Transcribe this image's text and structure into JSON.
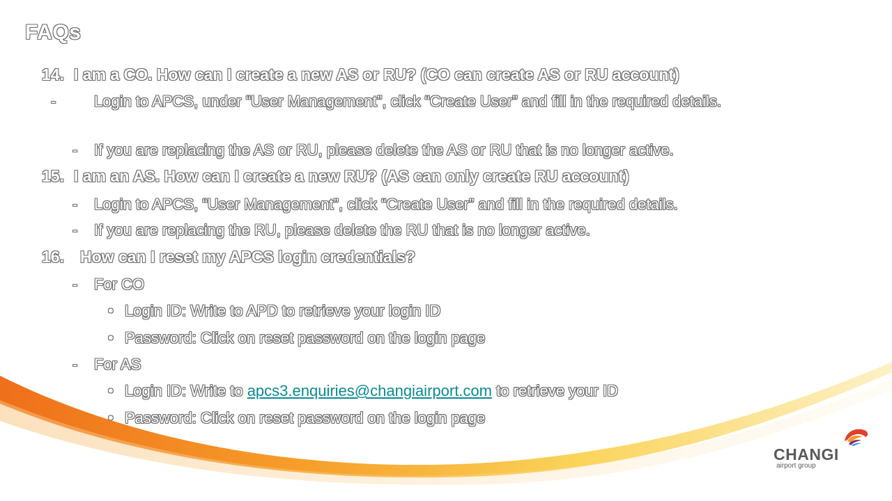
{
  "slide": {
    "title": "FAQs"
  },
  "faq": {
    "q14": {
      "num": "14.",
      "text": "I am a CO. How can I create a new AS or RU? (CO can create AS or RU account)",
      "b1": "Login to APCS, under “User Management”, click “Create User” and fill in the required details.",
      "b2": "If you are replacing the AS or RU, please delete the AS or RU that is no longer active."
    },
    "q15": {
      "num": "15.",
      "text": "I am an AS. How can I create a new RU? (AS can only create RU account)",
      "b1": "Login to APCS, “User Management”, click “Create User” and fill in the required details.",
      "b2": "If you are replacing the RU, please delete the RU that is no longer active."
    },
    "q16": {
      "num": "16.",
      "text": "How can I reset my APCS login credentials?",
      "co": {
        "label": "For CO",
        "login": "Login ID: Write to APD to retrieve your login ID",
        "password": "Password: Click on reset password on the login page"
      },
      "as": {
        "label": "For AS",
        "login_prefix": "Login ID: Write to",
        "email": "apcs3.enquiries@changiairport.com",
        "login_suffix": "to retrieve your ID",
        "password": "Password: Click on reset password on the login page"
      }
    }
  },
  "symbols": {
    "dash": "-",
    "dot": "•"
  },
  "logo": {
    "name": "CHANGI",
    "sub": "airport group",
    "mark_icon": "changi-bird-icon"
  },
  "colors": {
    "swoosh_orange": "#f07a1a",
    "swoosh_yellow": "#fbd45a",
    "link": "#0b8a92",
    "outline": "#6b6b6b"
  }
}
